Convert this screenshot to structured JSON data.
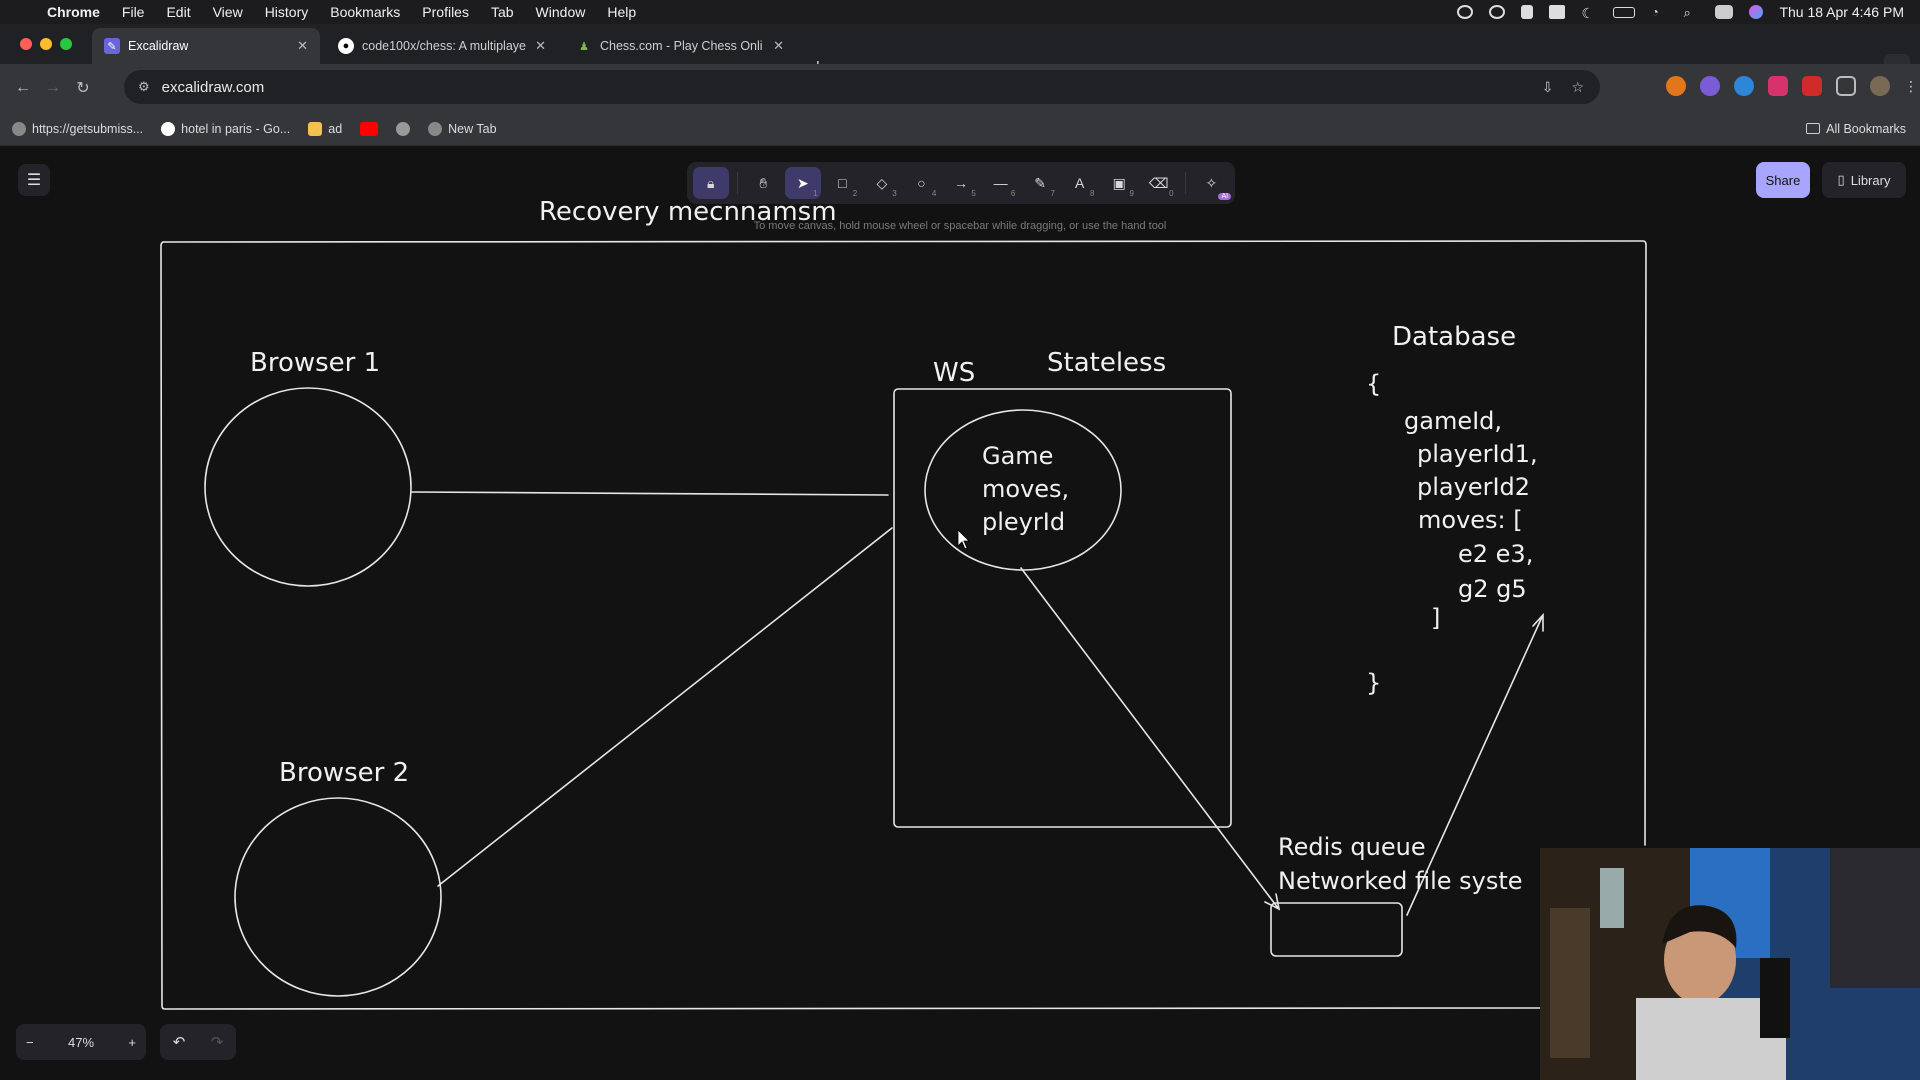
{
  "menubar": {
    "app": "Chrome",
    "items": [
      "File",
      "Edit",
      "View",
      "History",
      "Bookmarks",
      "Profiles",
      "Tab",
      "Window",
      "Help"
    ],
    "clock": "Thu 18 Apr  4:46 PM"
  },
  "tabs": [
    {
      "title": "Excalidraw",
      "icon": "excalidraw-icon"
    },
    {
      "title": "code100x/chess: A multiplaye",
      "icon": "github-icon"
    },
    {
      "title": "Chess.com - Play Chess Onli",
      "icon": "chess-icon"
    }
  ],
  "address": {
    "url": "excalidraw.com"
  },
  "bookmarks": [
    {
      "label": "https://getsubmiss..."
    },
    {
      "label": "hotel in paris - Go..."
    },
    {
      "label": "ad"
    },
    {
      "label": ""
    },
    {
      "label": ""
    },
    {
      "label": "New Tab"
    }
  ],
  "all_bookmarks": "All Bookmarks",
  "excalidraw": {
    "hint": "To move canvas, hold mouse wheel or spacebar while dragging, or use the hand tool",
    "share": "Share",
    "library": "Library",
    "zoom": "47%",
    "tools": [
      {
        "name": "lock-icon",
        "key": ""
      },
      {
        "name": "hand-icon",
        "key": ""
      },
      {
        "name": "selection-icon",
        "key": "1"
      },
      {
        "name": "rectangle-icon",
        "key": "2"
      },
      {
        "name": "diamond-icon",
        "key": "3"
      },
      {
        "name": "ellipse-icon",
        "key": "4"
      },
      {
        "name": "arrow-icon",
        "key": "5"
      },
      {
        "name": "line-icon",
        "key": "6"
      },
      {
        "name": "pencil-icon",
        "key": "7"
      },
      {
        "name": "text-icon",
        "key": "8"
      },
      {
        "name": "image-icon",
        "key": "9"
      },
      {
        "name": "eraser-icon",
        "key": "0"
      },
      {
        "name": "ai-tools-icon",
        "key": "AI"
      }
    ]
  },
  "drawing": {
    "title": "Recovery mecnnamsm",
    "browser1": "Browser 1",
    "browser2": "Browser 2",
    "ws": "WS",
    "stateless": "Stateless",
    "game_lines": [
      "Game",
      "moves,",
      "pleyrId"
    ],
    "database": "Database",
    "db_lines": [
      "{",
      "gameId,",
      "playerId1,",
      "playerId2",
      "moves: [",
      "e2 e3,",
      "g2 g5",
      "]",
      "}"
    ],
    "redis": "Redis queue",
    "nfs": "Networked file syste"
  }
}
